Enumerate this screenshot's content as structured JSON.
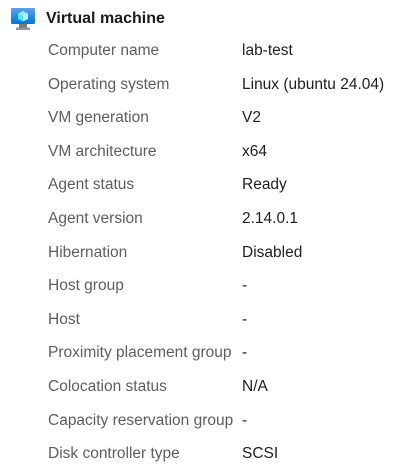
{
  "section": {
    "icon": "virtual-machine-icon",
    "title": "Virtual machine"
  },
  "properties": [
    {
      "label": "Computer name",
      "value": "lab-test"
    },
    {
      "label": "Operating system",
      "value": "Linux (ubuntu 24.04)"
    },
    {
      "label": "VM generation",
      "value": "V2"
    },
    {
      "label": "VM architecture",
      "value": "x64"
    },
    {
      "label": "Agent status",
      "value": "Ready"
    },
    {
      "label": "Agent version",
      "value": "2.14.0.1"
    },
    {
      "label": "Hibernation",
      "value": "Disabled"
    },
    {
      "label": "Host group",
      "value": "-"
    },
    {
      "label": "Host",
      "value": "-"
    },
    {
      "label": "Proximity placement group",
      "value": "-"
    },
    {
      "label": "Colocation status",
      "value": "N/A"
    },
    {
      "label": "Capacity reservation group",
      "value": "-"
    },
    {
      "label": "Disk controller type",
      "value": "SCSI"
    }
  ],
  "colors": {
    "icon_blue": "#0078d4",
    "label_text": "#605e5c",
    "value_text": "#201f1e"
  }
}
